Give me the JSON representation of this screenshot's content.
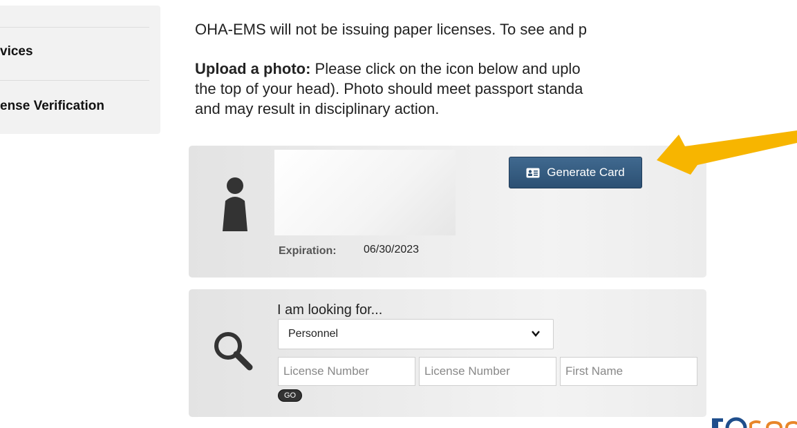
{
  "sidebar": {
    "items": [
      {
        "label": "vices"
      },
      {
        "label": "ense Verification"
      }
    ]
  },
  "notice": {
    "line1": "OHA-EMS will not be issuing paper licenses. To see and p",
    "upload_bold": "Upload a photo:",
    "upload_rest": " Please click on the icon below and uplo",
    "line3": "the top of your head). Photo should meet passport standa",
    "line4": "and may result in disciplinary action."
  },
  "card_panel": {
    "generate_label": "Generate Card",
    "expiration_label": "Expiration:",
    "expiration_value": "06/30/2023"
  },
  "search_panel": {
    "looking_label": "I am looking for...",
    "select_value": "Personnel",
    "inputs": [
      {
        "placeholder": "License Number"
      },
      {
        "placeholder": "License Number"
      },
      {
        "placeholder": "First Name"
      }
    ],
    "go_label": "GO"
  },
  "colors": {
    "button": "#2f5577",
    "arrow": "#f7b500",
    "logo_blue": "#1f4e8c",
    "logo_orange": "#e8862a"
  },
  "icons": [
    "person-icon",
    "id-card-icon",
    "magnifier-icon",
    "chevron-down-icon",
    "callout-arrow",
    "oregon-logo"
  ]
}
